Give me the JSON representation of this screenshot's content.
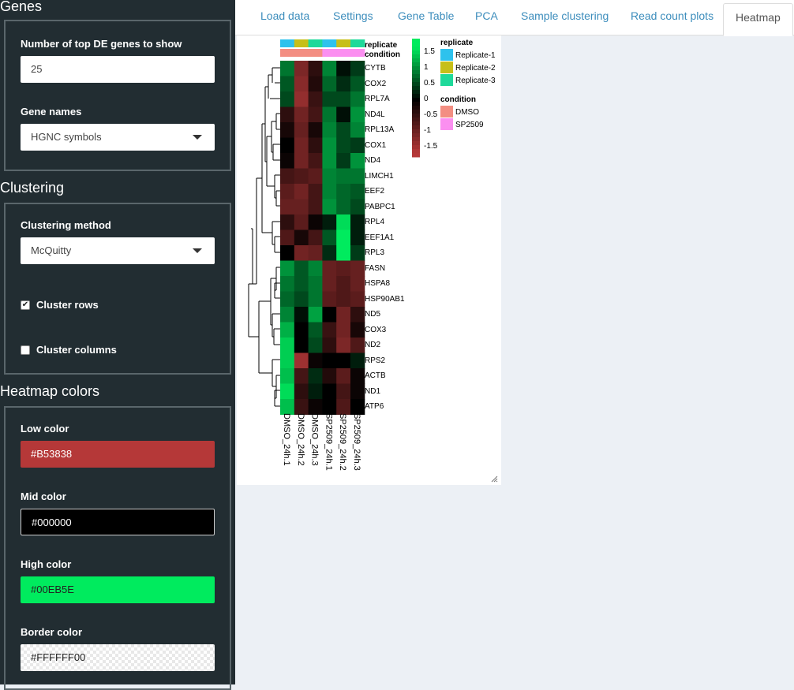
{
  "sidebar": {
    "genes_title": "Genes",
    "top_genes_label": "Number of top DE genes to show",
    "top_genes_value": "25",
    "gene_names_label": "Gene names",
    "gene_names_value": "HGNC symbols",
    "clustering_title": "Clustering",
    "clustering_method_label": "Clustering method",
    "clustering_method_value": "McQuitty",
    "cluster_rows_label": "Cluster rows",
    "cluster_rows_checked": true,
    "cluster_columns_label": "Cluster columns",
    "cluster_columns_checked": false,
    "heatmap_colors_title": "Heatmap colors",
    "low_color_label": "Low color",
    "low_color_value": "#B53838",
    "mid_color_label": "Mid color",
    "mid_color_value": "#000000",
    "high_color_label": "High color",
    "high_color_value": "#00EB5E",
    "border_color_label": "Border color",
    "border_color_value": "#FFFFFF00"
  },
  "tabs": [
    {
      "label": "Load data",
      "active": false
    },
    {
      "label": "Settings",
      "active": false
    },
    {
      "label": "Gene Table",
      "active": false
    },
    {
      "label": "PCA",
      "active": false
    },
    {
      "label": "Sample clustering",
      "active": false
    },
    {
      "label": "Read count plots",
      "active": false
    },
    {
      "label": "Heatmap",
      "active": true
    }
  ],
  "heatmap": {
    "columns": [
      "DMSO_24h.1",
      "DMSO_24h.2",
      "DMSO_24h.3",
      "SP2509_24h.1",
      "SP2509_24h.2",
      "SP2509_24h.3"
    ],
    "rows": [
      "CYTB",
      "COX2",
      "RPL7A",
      "ND4L",
      "RPL13A",
      "COX1",
      "ND4",
      "LIMCH1",
      "EEF2",
      "PABPC1",
      "RPL4",
      "EEF1A1",
      "RPL3",
      "FASN",
      "HSPA8",
      "HSP90AB1",
      "ND5",
      "COX3",
      "ND2",
      "RPS2",
      "ACTB",
      "ND1",
      "ATP6"
    ],
    "values": [
      [
        0.8,
        -1.1,
        -0.4,
        0.9,
        0.1,
        0.4
      ],
      [
        0.6,
        -1.2,
        -0.3,
        0.7,
        0.3,
        0.6
      ],
      [
        0.5,
        -1.3,
        -0.5,
        0.5,
        0.5,
        0.8
      ],
      [
        -0.4,
        -1.0,
        -0.6,
        0.8,
        0.1,
        1.0
      ],
      [
        -0.2,
        -0.9,
        -0.2,
        0.9,
        0.5,
        0.9
      ],
      [
        0.0,
        -1.0,
        -0.4,
        1.0,
        0.5,
        0.4
      ],
      [
        -0.1,
        -1.0,
        -0.6,
        1.0,
        0.4,
        1.0
      ],
      [
        -0.6,
        -0.7,
        -0.8,
        0.9,
        0.8,
        0.8
      ],
      [
        -0.8,
        -1.0,
        -0.6,
        0.9,
        0.7,
        0.6
      ],
      [
        -0.9,
        -0.9,
        -0.6,
        1.0,
        0.7,
        0.5
      ],
      [
        -0.4,
        -0.8,
        -0.1,
        0.2,
        1.5,
        0.2
      ],
      [
        -0.7,
        -0.2,
        -0.6,
        0.6,
        1.6,
        0.2
      ],
      [
        0.0,
        -1.0,
        -0.9,
        0.3,
        1.6,
        0.4
      ],
      [
        1.0,
        0.6,
        0.9,
        -0.9,
        -0.8,
        -0.9
      ],
      [
        0.8,
        0.6,
        0.8,
        -0.9,
        -0.7,
        -0.9
      ],
      [
        0.7,
        0.5,
        0.8,
        -0.8,
        -0.7,
        -0.8
      ],
      [
        0.9,
        0.1,
        1.1,
        0.0,
        -1.0,
        -0.4
      ],
      [
        1.2,
        0.0,
        0.6,
        -0.5,
        -1.0,
        -0.2
      ],
      [
        1.4,
        0.0,
        0.5,
        -0.4,
        -1.1,
        -0.7
      ],
      [
        1.4,
        -1.4,
        -0.1,
        0.0,
        0.0,
        0.2
      ],
      [
        1.3,
        -0.6,
        0.3,
        -0.3,
        -0.8,
        -0.1
      ],
      [
        1.5,
        -0.4,
        0.2,
        0.0,
        -0.6,
        -0.1
      ],
      [
        1.3,
        -0.5,
        -0.1,
        0.0,
        -0.7,
        0.0
      ]
    ],
    "replicate_annotation": [
      "Replicate-1",
      "Replicate-2",
      "Replicate-3",
      "Replicate-1",
      "Replicate-2",
      "Replicate-3"
    ],
    "condition_annotation": [
      "DMSO",
      "DMSO",
      "DMSO",
      "SP2509",
      "SP2509",
      "SP2509"
    ],
    "annotation_row_labels": [
      "replicate",
      "condition"
    ],
    "scale_ticks": [
      "1.5",
      "1",
      "0.5",
      "0",
      "-0.5",
      "-1",
      "-1.5"
    ],
    "legend": {
      "replicate_title": "replicate",
      "replicate_items": [
        {
          "label": "Replicate-1",
          "color": "#2ec2ed"
        },
        {
          "label": "Replicate-2",
          "color": "#c6bf19"
        },
        {
          "label": "Replicate-3",
          "color": "#1ed99a"
        }
      ],
      "condition_title": "condition",
      "condition_items": [
        {
          "label": "DMSO",
          "color": "#f38e82"
        },
        {
          "label": "SP2509",
          "color": "#fb8ff0"
        }
      ]
    }
  }
}
